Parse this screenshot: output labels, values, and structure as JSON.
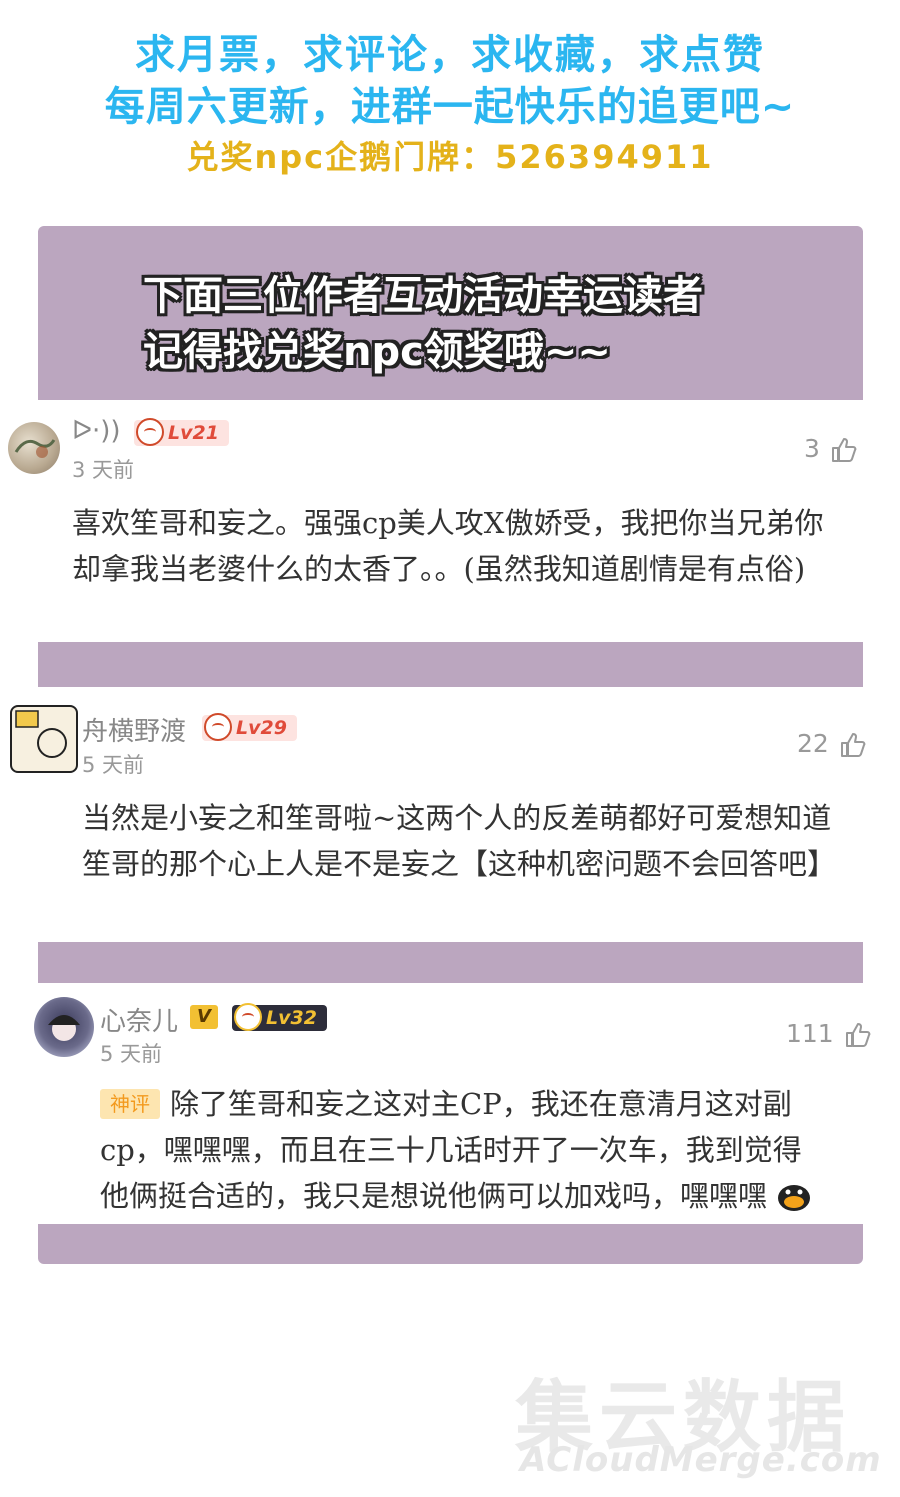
{
  "header": {
    "line1": "求月票，求评论，求收藏，求点赞",
    "line2": "每周六更新，进群一起快乐的追更吧~",
    "line3": "兑奖npc企鹅门牌：526394911"
  },
  "banner": {
    "line1": "下面三位作者互动活动幸运读者",
    "line2": "记得找兑奖npc领奖哦~~"
  },
  "comments": [
    {
      "username": "ᐅ·))",
      "level": "Lv21",
      "time": "3 天前",
      "likes": "3",
      "text": "喜欢笙哥和妄之。强强cp美人攻X傲娇受，我把你当兄弟你却拿我当老婆什么的太香了。。(虽然我知道剧情是有点俗)"
    },
    {
      "username": "舟横野渡",
      "level": "Lv29",
      "time": "5 天前",
      "likes": "22",
      "text": "当然是小妄之和笙哥啦~这两个人的反差萌都好可爱想知道笙哥的那个心上人是不是妄之【这种机密问题不会回答吧】"
    },
    {
      "username": "心奈儿",
      "vip": "V",
      "level": "Lv32",
      "time": "5 天前",
      "likes": "111",
      "tag": "神评",
      "text": "除了笙哥和妄之这对主CP，我还在意清月这对副cp，嘿嘿嘿，而且在三十几话时开了一次车，我到觉得他俩挺合适的，我只是想说他俩可以加戏吗，嘿嘿嘿"
    }
  ],
  "watermark": {
    "cn": "集云数据",
    "en": "ACloudMerge.com"
  },
  "colors": {
    "header_blue": "#2bb6f0",
    "header_gold": "#e4b21a",
    "band": "#bba6bf",
    "tag_bg": "#fde5b0",
    "tag_text": "#f39a1e"
  }
}
